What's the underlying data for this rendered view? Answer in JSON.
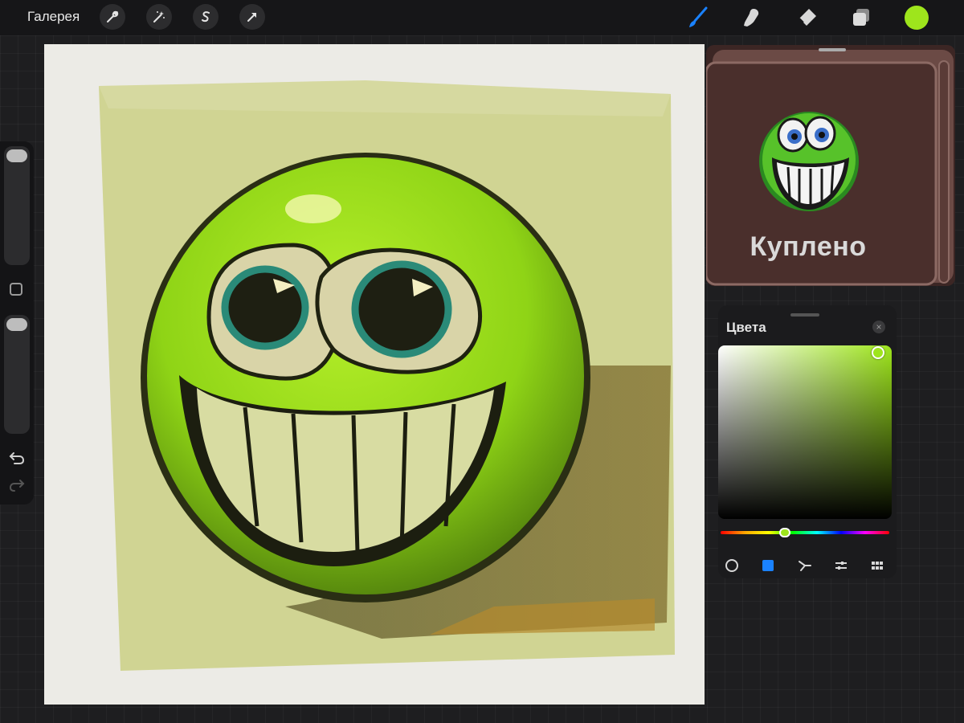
{
  "topbar": {
    "gallery_label": "Галерея",
    "left_tools": [
      {
        "name": "actions",
        "icon": "wrench-icon"
      },
      {
        "name": "adjustments",
        "icon": "magic-wand-icon"
      },
      {
        "name": "selection",
        "icon": "selection-s-icon"
      },
      {
        "name": "transform",
        "icon": "arrow-cursor-icon"
      }
    ],
    "right_tools": [
      {
        "name": "paint",
        "icon": "brush-icon",
        "active": true
      },
      {
        "name": "smudge",
        "icon": "smudge-finger-icon"
      },
      {
        "name": "erase",
        "icon": "eraser-icon"
      },
      {
        "name": "layers",
        "icon": "layers-icon"
      }
    ],
    "current_color": "#9ee51c"
  },
  "sidebar": {
    "brush_size_icon": "brush-size-slider",
    "opacity_icon": "opacity-slider",
    "modify_icon": "square-modify-icon",
    "undo_icon": "undo-arrow-icon",
    "redo_icon": "redo-arrow-icon"
  },
  "reference": {
    "label": "Куплено"
  },
  "colors_panel": {
    "title": "Цвета",
    "close_icon": "close-x-icon",
    "hue_position": 0.38,
    "saturation": 0.92,
    "brightness": 0.96,
    "tabs": [
      {
        "name": "disc",
        "icon": "circle-icon"
      },
      {
        "name": "classic",
        "icon": "square-icon",
        "active": true
      },
      {
        "name": "harmony",
        "icon": "harmony-icon"
      },
      {
        "name": "value",
        "icon": "sliders-icon"
      },
      {
        "name": "palettes",
        "icon": "grid-icon"
      }
    ]
  },
  "colors": {
    "accent_blue": "#1a82ff",
    "canvas_bg": "#ecebe6",
    "paper_green": "#cfd38e",
    "smiley_green": "#9ee51c",
    "card_brown": "#4a2f2c"
  }
}
